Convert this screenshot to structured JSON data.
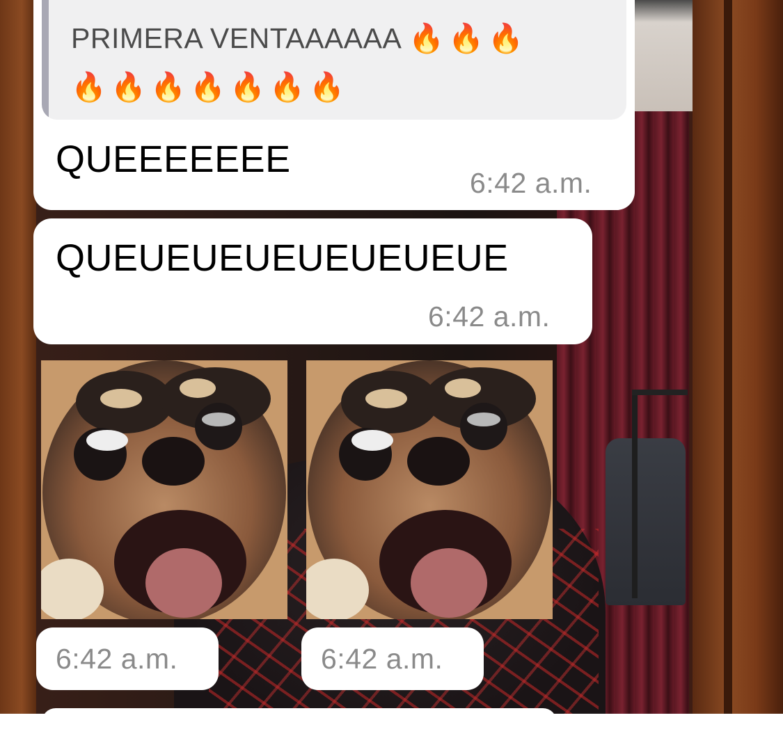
{
  "quoted_message": {
    "text": "PRIMERA VENTAAAAAA",
    "flames_line1": "🔥🔥🔥",
    "flames_line2": "🔥🔥🔥🔥🔥🔥🔥"
  },
  "messages": [
    {
      "text": "QUEEEEEEE",
      "time": "6:42 a.m."
    },
    {
      "text": "QUEUEUEUEUEUEUEUE",
      "time": "6:42 a.m."
    }
  ],
  "stickers": [
    {
      "icon": "screaming-chihuahua-sticker",
      "time": "6:42 a.m."
    },
    {
      "icon": "screaming-chihuahua-sticker",
      "time": "6:42 a.m."
    }
  ],
  "colors": {
    "bubble": "#ffffff",
    "quote_background": "#f0f0f1",
    "quote_bar": "#a8a8b4",
    "timestamp": "#8a8a8a"
  }
}
